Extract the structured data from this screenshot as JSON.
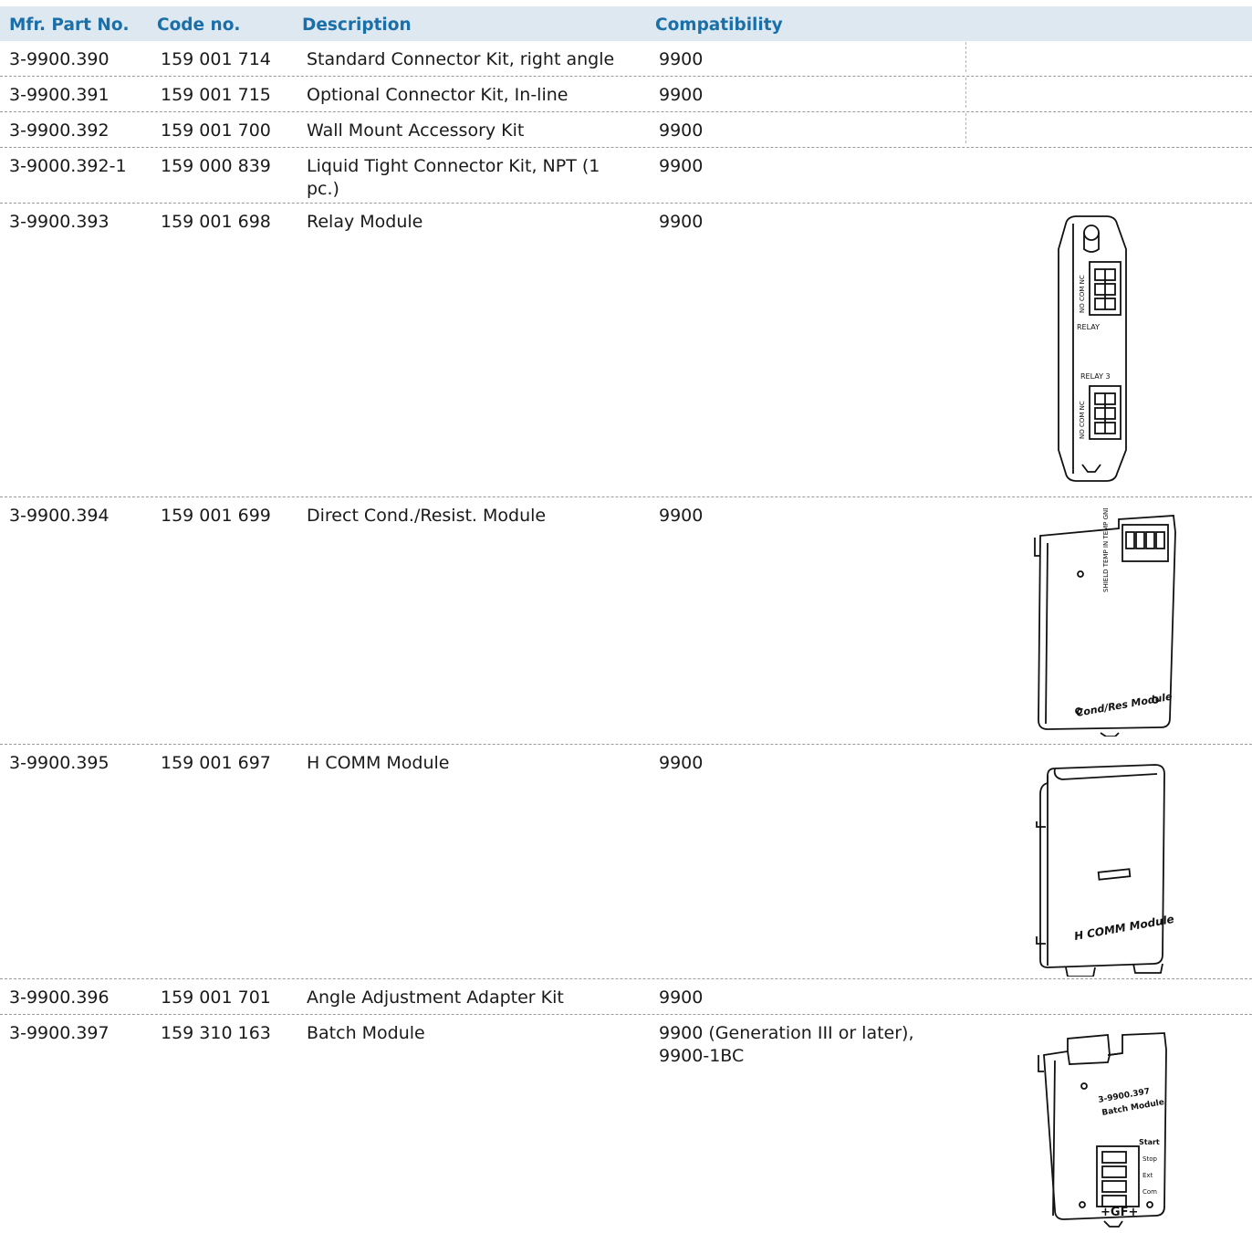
{
  "table": {
    "headers": [
      "Mfr. Part No.",
      "Code no.",
      "Description",
      "Compatibility"
    ],
    "rows": [
      {
        "part": "3-9900.390",
        "code": "159 001 714",
        "desc": "Standard Connector Kit, right angle",
        "compat": "9900"
      },
      {
        "part": "3-9900.391",
        "code": "159 001 715",
        "desc": "Optional Connector Kit, In-line",
        "compat": "9900"
      },
      {
        "part": "3-9900.392",
        "code": "159 001 700",
        "desc": "Wall Mount Accessory Kit",
        "compat": "9900"
      },
      {
        "part": "3-9000.392-1",
        "code": "159 000 839",
        "desc": "Liquid Tight Connector Kit, NPT (1 pc.)",
        "compat": "9900"
      },
      {
        "part": "3-9900.393",
        "code": "159 001 698",
        "desc": "Relay Module",
        "compat": "9900",
        "image": "relay-module-illustration"
      },
      {
        "part": "3-9900.394",
        "code": "159 001 699",
        "desc": "Direct Cond./Resist. Module",
        "compat": "9900",
        "image": "cond-res-module-illustration"
      },
      {
        "part": "3-9900.395",
        "code": "159 001 697",
        "desc": "H COMM Module",
        "compat": "9900",
        "image": "h-comm-module-illustration"
      },
      {
        "part": "3-9900.396",
        "code": "159 001 701",
        "desc": "Angle Adjustment Adapter Kit",
        "compat": "9900"
      },
      {
        "part": "3-9900.397",
        "code": "159 310 163",
        "desc": "Batch Module",
        "compat": "9900 (Generation III or later), 9900-1BC",
        "image": "batch-module-illustration"
      }
    ]
  },
  "illustrations": {
    "relay": {
      "label_top": "RELAY",
      "label_bottom": "RELAY 3",
      "pins": "NO COM NC"
    },
    "cond": {
      "label": "Cond/Res Module",
      "pins": "SHIELD TEMP IN TEMP GND SIGNAL GND SIGNAL"
    },
    "hcomm": {
      "label": "H COMM Module"
    },
    "batch": {
      "label_1": "3-9900.397",
      "label_2": "Batch Module",
      "pin_1": "Start",
      "pin_2": "Stop",
      "pin_3": "Ext",
      "pin_4": "Com",
      "logo": "+GF+"
    }
  },
  "colors": {
    "header_bg": "#dde8f1",
    "header_text": "#1a6fa8"
  }
}
